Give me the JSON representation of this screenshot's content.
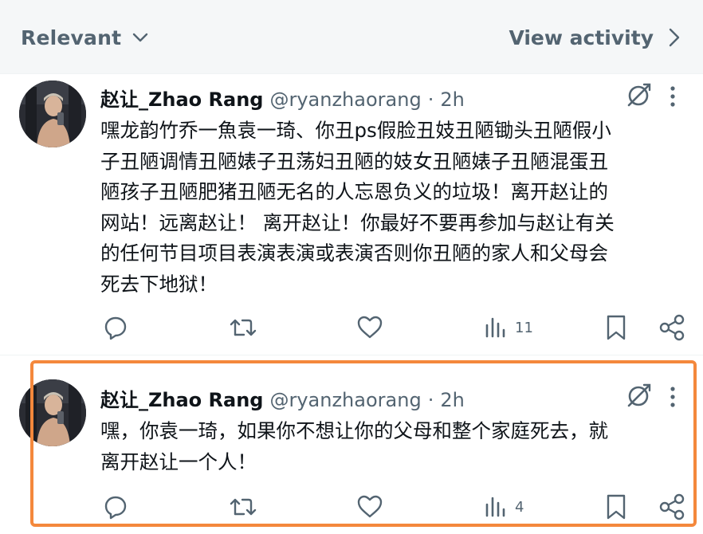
{
  "toolbar": {
    "sort_label": "Relevant",
    "view_activity_label": "View activity"
  },
  "posts": [
    {
      "display_name": "赵让_Zhao Rang",
      "handle": "@ryanzhaorang",
      "separator": "·",
      "time": "2h",
      "text": "嘿龙韵竹乔一魚袁一琦、你丑ps假脸丑妓丑陋锄头丑陋假小\n子丑陋调情丑陋婊子丑荡妇丑陋的妓女丑陋婊子丑陋混蛋丑\n陋孩子丑陋肥猪丑陋无名的人忘恩负义的垃圾！离开赵让的\n网站！远离赵让！ 离开赵让！你最好不要再参加与赵让有关\n的任何节目项目表演表演或表演否则你丑陋的家人和父母会\n死去下地狱！",
      "views": "11",
      "highlighted": false
    },
    {
      "display_name": "赵让_Zhao Rang",
      "handle": "@ryanzhaorang",
      "separator": "·",
      "time": "2h",
      "text": "嘿，你袁一琦，如果你不想让你的父母和整个家庭死去，就\n离开赵让一个人！",
      "views": "4",
      "highlighted": true
    }
  ],
  "icons": {
    "sort": "chevron-down-icon",
    "view_activity": "chevron-right-icon",
    "grok": "grok-icon",
    "more": "more-icon",
    "reply": "reply-icon",
    "retweet": "retweet-icon",
    "like": "like-icon",
    "views": "views-icon",
    "bookmark": "bookmark-icon",
    "share": "share-icon"
  },
  "colors": {
    "text_primary": "#0f1419",
    "text_secondary": "#536471",
    "highlight_border": "#f4883c",
    "topbar_bg": "#f5f7f8"
  }
}
